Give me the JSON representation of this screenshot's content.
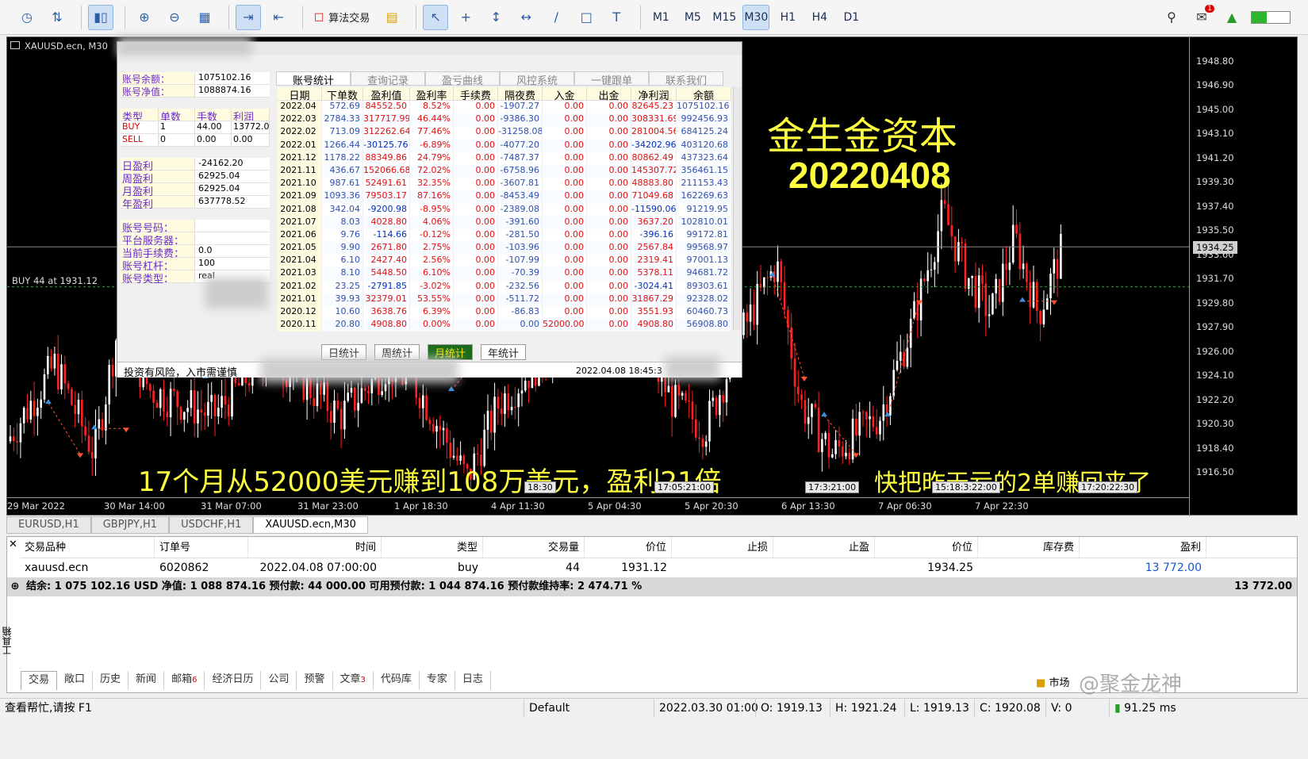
{
  "toolbar": {
    "algo_trading_label": "算法交易",
    "timeframes": [
      "M1",
      "M5",
      "M15",
      "M30",
      "H1",
      "H4",
      "D1"
    ],
    "active_timeframe": "M30",
    "notifications_count": "1"
  },
  "chart": {
    "window_title": "XAUUSD.ecn, M30",
    "position_line_label": "BUY 44 at 1931.12",
    "current_price": "1934.25",
    "price_ticks": [
      "1948.80",
      "1946.90",
      "1945.00",
      "1943.10",
      "1941.20",
      "1939.30",
      "1937.40",
      "1935.50",
      "1933.60",
      "1931.70",
      "1929.80",
      "1927.90",
      "1926.00",
      "1924.10",
      "1922.20",
      "1920.30",
      "1918.40",
      "1916.50"
    ],
    "time_ticks": [
      "29 Mar 2022",
      "30 Mar 14:00",
      "31 Mar 07:00",
      "31 Mar 23:00",
      "1 Apr 18:30",
      "4 Apr 11:30",
      "5 Apr 04:30",
      "5 Apr 20:30",
      "6 Apr 13:30",
      "7 Apr 06:30",
      "7 Apr 22:30"
    ],
    "trade_time_labels": [
      "18:30",
      "17:05:21:00",
      "17:3:21:00",
      "15:18:3:22:00",
      "17:20:22:30"
    ],
    "overlay_title": "金生金资本",
    "overlay_date": "20220408",
    "overlay_caption": "17个月从52000美元赚到108万美元，盈利21倍",
    "overlay_note": "快把昨天亏的2单赚回来了",
    "colors": {
      "up": "#ffffff",
      "down": "#ff2020",
      "overlay_text": "#ffff40",
      "position_line": "#00c000"
    }
  },
  "stats_panel": {
    "balance_label": "账号余额：",
    "balance": "1075102.16",
    "equity_label": "账号净值：",
    "equity": "1088874.16",
    "pos_headers": [
      "类型",
      "单数",
      "手数",
      "利润"
    ],
    "pos_rows": [
      [
        "BUY",
        "1",
        "44.00",
        "13772.0"
      ],
      [
        "SELL",
        "0",
        "0.00",
        "0.00"
      ]
    ],
    "profit_labels": [
      "日盈利",
      "周盈利",
      "月盈利",
      "年盈利"
    ],
    "profit_values": [
      "-24162.20",
      "62925.04",
      "62925.04",
      "637778.52"
    ],
    "acct_labels": [
      "账号号码：",
      "平台服务器：",
      "当前手续费：",
      "账号杠杆：",
      "账号类型："
    ],
    "acct_values": [
      "",
      "",
      "0.0",
      "100",
      "real"
    ],
    "tabs": [
      "账号统计",
      "查询记录",
      "盈亏曲线",
      "风控系统",
      "一键跟单",
      "联系我们"
    ],
    "active_tab": "账号统计",
    "grid_headers": [
      "日期",
      "下单数",
      "盈利值",
      "盈利率",
      "手续费",
      "隔夜费",
      "入金",
      "出金",
      "净利润",
      "余额"
    ],
    "grid_rows": [
      [
        "2022.04",
        "572.69",
        "84552.50",
        "8.52%",
        "0.00",
        "-1907.27",
        "0.00",
        "0.00",
        "82645.23",
        "1075102.16"
      ],
      [
        "2022.03",
        "2784.33",
        "317717.99",
        "46.44%",
        "0.00",
        "-9386.30",
        "0.00",
        "0.00",
        "308331.69",
        "992456.93"
      ],
      [
        "2022.02",
        "713.09",
        "312262.64",
        "77.46%",
        "0.00",
        "-31258.08",
        "0.00",
        "0.00",
        "281004.56",
        "684125.24"
      ],
      [
        "2022.01",
        "1266.44",
        "-30125.76",
        "-6.89%",
        "0.00",
        "-4077.20",
        "0.00",
        "0.00",
        "-34202.96",
        "403120.68"
      ],
      [
        "2021.12",
        "1178.22",
        "88349.86",
        "24.79%",
        "0.00",
        "-7487.37",
        "0.00",
        "0.00",
        "80862.49",
        "437323.64"
      ],
      [
        "2021.11",
        "436.67",
        "152066.68",
        "72.02%",
        "0.00",
        "-6758.96",
        "0.00",
        "0.00",
        "145307.72",
        "356461.15"
      ],
      [
        "2021.10",
        "987.61",
        "52491.61",
        "32.35%",
        "0.00",
        "-3607.81",
        "0.00",
        "0.00",
        "48883.80",
        "211153.43"
      ],
      [
        "2021.09",
        "1093.36",
        "79503.17",
        "87.16%",
        "0.00",
        "-8453.49",
        "0.00",
        "0.00",
        "71049.68",
        "162269.63"
      ],
      [
        "2021.08",
        "342.04",
        "-9200.98",
        "-8.95%",
        "0.00",
        "-2389.08",
        "0.00",
        "0.00",
        "-11590.06",
        "91219.95"
      ],
      [
        "2021.07",
        "8.03",
        "4028.80",
        "4.06%",
        "0.00",
        "-391.60",
        "0.00",
        "0.00",
        "3637.20",
        "102810.01"
      ],
      [
        "2021.06",
        "9.76",
        "-114.66",
        "-0.12%",
        "0.00",
        "-281.50",
        "0.00",
        "0.00",
        "-396.16",
        "99172.81"
      ],
      [
        "2021.05",
        "9.90",
        "2671.80",
        "2.75%",
        "0.00",
        "-103.96",
        "0.00",
        "0.00",
        "2567.84",
        "99568.97"
      ],
      [
        "2021.04",
        "6.10",
        "2427.40",
        "2.56%",
        "0.00",
        "-107.99",
        "0.00",
        "0.00",
        "2319.41",
        "97001.13"
      ],
      [
        "2021.03",
        "8.10",
        "5448.50",
        "6.10%",
        "0.00",
        "-70.39",
        "0.00",
        "0.00",
        "5378.11",
        "94681.72"
      ],
      [
        "2021.02",
        "23.25",
        "-2791.85",
        "-3.02%",
        "0.00",
        "-232.56",
        "0.00",
        "0.00",
        "-3024.41",
        "89303.61"
      ],
      [
        "2021.01",
        "39.93",
        "32379.01",
        "53.55%",
        "0.00",
        "-511.72",
        "0.00",
        "0.00",
        "31867.29",
        "92328.02"
      ],
      [
        "2020.12",
        "10.60",
        "3638.76",
        "6.39%",
        "0.00",
        "-86.83",
        "0.00",
        "0.00",
        "3551.93",
        "60460.73"
      ],
      [
        "2020.11",
        "20.80",
        "4908.80",
        "0.00%",
        "0.00",
        "0.00",
        "52000.00",
        "0.00",
        "4908.80",
        "56908.80"
      ]
    ],
    "period_buttons": [
      "日统计",
      "周统计",
      "月统计",
      "年统计"
    ],
    "active_period": "月统计",
    "risk_text": "投资有风险，入市需谨慎",
    "timestamp": "2022.04.08 18:45:3"
  },
  "chart_tabs": [
    "EURUSD,H1",
    "GBPJPY,H1",
    "USDCHF,H1",
    "XAUUSD.ecn,M30"
  ],
  "active_chart_tab": "XAUUSD.ecn,M30",
  "terminal": {
    "headers": [
      "交易品种",
      "订单号",
      "时间",
      "类型",
      "交易量",
      "价位",
      "止损",
      "止盈",
      "价位",
      "库存费",
      "盈利"
    ],
    "row": [
      "xauusd.ecn",
      "6020862",
      "2022.04.08 07:00:00",
      "buy",
      "44",
      "1931.12",
      "",
      "",
      "1934.25",
      "",
      "13 772.00"
    ],
    "summary": "结余: 1 075 102.16 USD  净值: 1 088 874.16  预付款: 44 000.00  可用预付款: 1 044 874.16  预付款维持率: 2 474.71 %",
    "summary_total": "13 772.00",
    "side_label": "工具箱",
    "tabs": [
      "交易",
      "敞口",
      "历史",
      "新闻",
      "邮箱",
      "经济日历",
      "公司",
      "预警",
      "文章",
      "代码库",
      "专家",
      "日志"
    ],
    "tab_badges": {
      "邮箱": "6",
      "文章": "3"
    },
    "active_tab": "交易",
    "market_label": "市场",
    "watermark": "@聚金龙神"
  },
  "statusbar": {
    "help": "查看帮忙,请按 F1",
    "profile": "Default",
    "datetime": "2022.03.30 01:00",
    "open": "O: 1919.13",
    "high": "H: 1921.24",
    "low": "L: 1919.13",
    "close": "C: 1920.08",
    "volume": "V: 0",
    "ping": "91.25 ms"
  }
}
